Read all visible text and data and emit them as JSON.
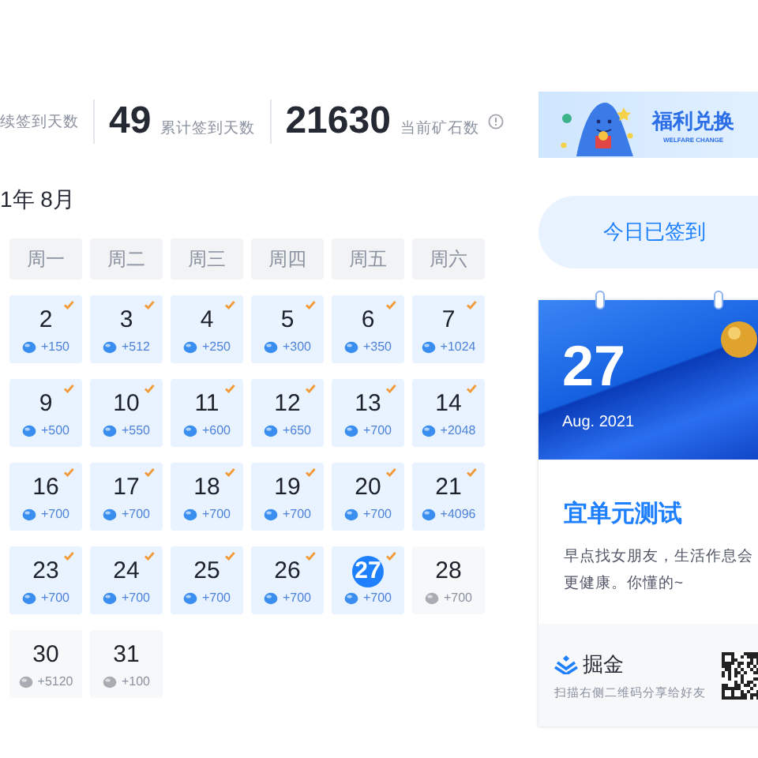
{
  "stats": [
    {
      "label": "续签到天数"
    },
    {
      "value": "49",
      "label": "累计签到天数"
    },
    {
      "value": "21630",
      "label": "当前矿石数",
      "info": true
    }
  ],
  "month_title": "1年 8月",
  "weekdays": [
    "周一",
    "周二",
    "周三",
    "周四",
    "周五",
    "周六"
  ],
  "days": [
    {
      "day": "2",
      "reward": "+150",
      "signed": true,
      "today": false
    },
    {
      "day": "3",
      "reward": "+512",
      "signed": true,
      "today": false
    },
    {
      "day": "4",
      "reward": "+250",
      "signed": true,
      "today": false
    },
    {
      "day": "5",
      "reward": "+300",
      "signed": true,
      "today": false
    },
    {
      "day": "6",
      "reward": "+350",
      "signed": true,
      "today": false
    },
    {
      "day": "7",
      "reward": "+1024",
      "signed": true,
      "today": false
    },
    {
      "day": "9",
      "reward": "+500",
      "signed": true,
      "today": false
    },
    {
      "day": "10",
      "reward": "+550",
      "signed": true,
      "today": false
    },
    {
      "day": "11",
      "reward": "+600",
      "signed": true,
      "today": false
    },
    {
      "day": "12",
      "reward": "+650",
      "signed": true,
      "today": false
    },
    {
      "day": "13",
      "reward": "+700",
      "signed": true,
      "today": false
    },
    {
      "day": "14",
      "reward": "+2048",
      "signed": true,
      "today": false
    },
    {
      "day": "16",
      "reward": "+700",
      "signed": true,
      "today": false
    },
    {
      "day": "17",
      "reward": "+700",
      "signed": true,
      "today": false
    },
    {
      "day": "18",
      "reward": "+700",
      "signed": true,
      "today": false
    },
    {
      "day": "19",
      "reward": "+700",
      "signed": true,
      "today": false
    },
    {
      "day": "20",
      "reward": "+700",
      "signed": true,
      "today": false
    },
    {
      "day": "21",
      "reward": "+4096",
      "signed": true,
      "today": false
    },
    {
      "day": "23",
      "reward": "+700",
      "signed": true,
      "today": false
    },
    {
      "day": "24",
      "reward": "+700",
      "signed": true,
      "today": false
    },
    {
      "day": "25",
      "reward": "+700",
      "signed": true,
      "today": false
    },
    {
      "day": "26",
      "reward": "+700",
      "signed": true,
      "today": false
    },
    {
      "day": "27",
      "reward": "+700",
      "signed": true,
      "today": true
    },
    {
      "day": "28",
      "reward": "+700",
      "signed": false,
      "today": false
    },
    {
      "day": "30",
      "reward": "+5120",
      "signed": false,
      "today": false
    },
    {
      "day": "31",
      "reward": "+100",
      "signed": false,
      "today": false
    }
  ],
  "banner": {
    "title": "福利兑换",
    "subtitle": "WELFARE CHANGE"
  },
  "checkin_button": {
    "label": "今日已签到"
  },
  "card": {
    "day": "27",
    "month": "Aug. 2021",
    "heading": "宜单元测试",
    "text": "早点找女朋友，生活作息会更健康。你懂的~",
    "brand": "掘金",
    "share": "扫描右侧二维码分享给好友"
  }
}
